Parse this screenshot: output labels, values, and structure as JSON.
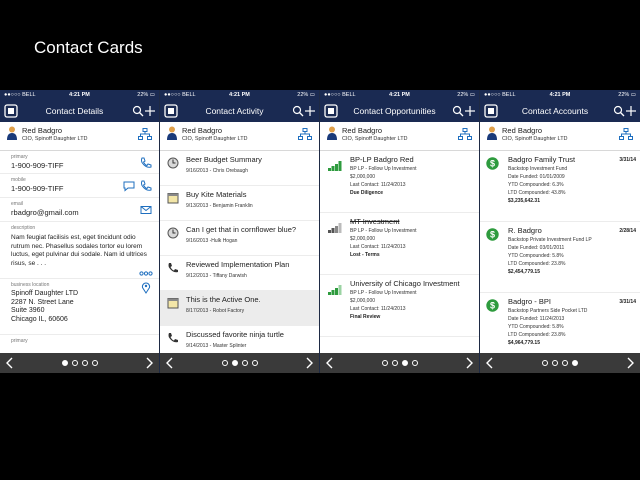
{
  "slide": {
    "title": "Contact Cards"
  },
  "common": {
    "carrier": "●●○○○ BELL",
    "time": "4:21 PM",
    "battery": "22% ▭",
    "contact_name": "Red Badgro",
    "contact_title": "CIO, Spinoff Daughter LTD"
  },
  "colors": {
    "nav": "#1a2a52",
    "accent": "#1f6fbf",
    "green": "#2e9b3e"
  },
  "screens": [
    {
      "nav_title": "Contact Details",
      "active_page": 0,
      "fields": [
        {
          "label": "primary",
          "value": "1-900-909-TIFF",
          "icon": "phone-icon"
        },
        {
          "label": "mobile",
          "value": "1-900-909-TIFF",
          "icon": "chat-phone-icon"
        },
        {
          "label": "email",
          "value": "rbadgro@gmail.com",
          "icon": "mail-icon"
        },
        {
          "label": "description",
          "value": "Nam feugiat facilisis est, eget tincidunt odio rutrum nec. Phasellus sodales tortor eu lorem luctus, eget pulvinar dui sodale. Nam id ultrices risus, se . . ."
        },
        {
          "label": "business location",
          "value": "Spinoff Daughter LTD",
          "line2": "2287 N. Street Lane",
          "line3": "Suite 3960",
          "line4": "Chicago IL, 60606",
          "icon": "location-pin-icon"
        },
        {
          "label": "primary",
          "value": ""
        }
      ]
    },
    {
      "nav_title": "Contact Activity",
      "active_page": 1,
      "items": [
        {
          "title": "Beer Budget Summary",
          "date": "9/16/2013",
          "who": "- Chris Orebaugh",
          "icon": "clock-icon"
        },
        {
          "title": "Buy Kite Materials",
          "date": "9/13/2013",
          "who": "- Benjamin Franklin",
          "icon": "calendar-icon"
        },
        {
          "title": "Can I get that in cornflower blue?",
          "date": "9/16/2013",
          "who": "-Hulk Hogan",
          "icon": "clock-icon"
        },
        {
          "title": "Reviewed Implementation Plan",
          "date": "9/12/2013",
          "who": "- Tiffany Darwish",
          "icon": "phone-icon"
        },
        {
          "title": "This is the Active One.",
          "date": "8/17/2013",
          "who": "- Robot Factory",
          "icon": "calendar-icon"
        },
        {
          "title": "Discussed favorite ninja turtle",
          "date": "9/14/2013",
          "who": "- Master Splinter",
          "icon": "phone-icon"
        }
      ]
    },
    {
      "nav_title": "Contact Opportunities",
      "active_page": 2,
      "items": [
        {
          "title": "BP-LP Badgro Red",
          "strike": false,
          "stage_line": "BP LP  - Follow Up Investment",
          "amount": "$2,000,000",
          "last_contact": "Last Contact:  11/24/2013",
          "status": "Due Diligence"
        },
        {
          "title": "MT Investment",
          "strike": true,
          "stage_line": "BP LP  - Follow Up Investment",
          "amount": "$2,000,000",
          "last_contact": "Last Contact:  11/24/2013",
          "status": "Lost - Terms"
        },
        {
          "title": "University of Chicago Investment",
          "strike": false,
          "stage_line": "BP LP  - Follow Up Investment",
          "amount": "$2,000,000",
          "last_contact": "Last Contact:  11/24/2013",
          "status": "Final Review"
        }
      ]
    },
    {
      "nav_title": "Contact Accounts",
      "active_page": 3,
      "items": [
        {
          "title": "Badgro Family Trust",
          "date": "3/31/14",
          "fund": "Backstop Investment Fund",
          "funded": "Date Funded:  01/01/2009",
          "ytd": "YTD Compounded:  6.3%",
          "ltd": "LTD Compounded:  43.8%",
          "total": "$3,235,642.31"
        },
        {
          "title": "R. Badgro",
          "date": "2/28/14",
          "fund": "Backstop Private Investment Fund LP",
          "funded": "Date Funded:  03/01/2011",
          "ytd": "YTD Compounded:  5.8%",
          "ltd": "LTD Compounded:  23.8%",
          "total": "$2,454,779.15"
        },
        {
          "title": "Badgro - BPI",
          "date": "3/31/14",
          "fund": "Backstop Partners Side Pocket LTD",
          "funded": "Date Funded:  11/24/2013",
          "ytd": "YTD Compounded:  5.8%",
          "ltd": "LTD Compounded:  23.8%",
          "total": "$4,964,779.15"
        }
      ]
    }
  ]
}
